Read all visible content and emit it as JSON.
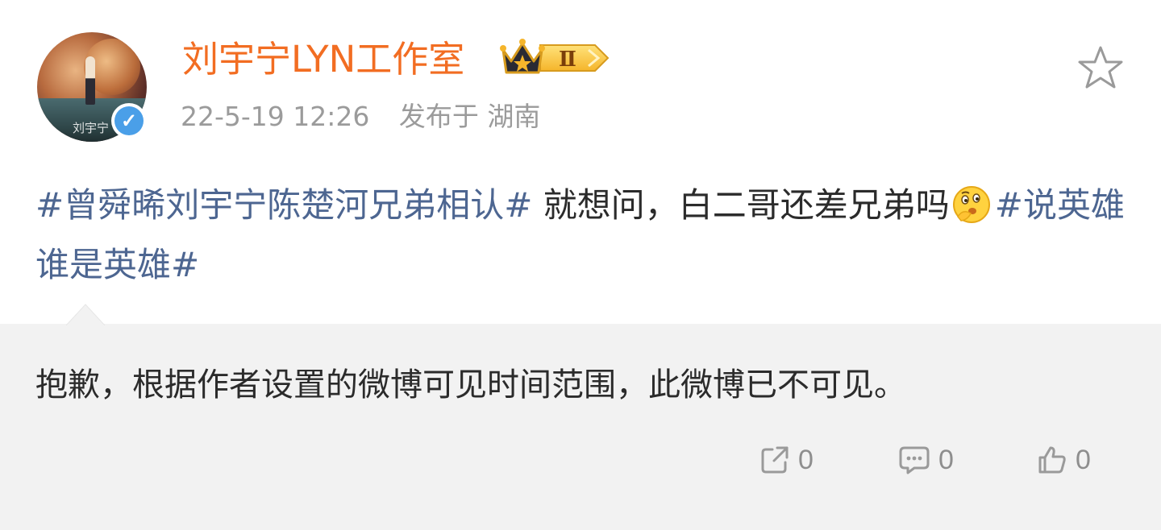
{
  "author": {
    "name": "刘宇宁LYN工作室",
    "avatar_caption": "刘宇宁",
    "verified_icon": "verified-v-icon",
    "vip_badge_icon": "crown-level-badge-icon",
    "vip_level_text": "Ⅱ",
    "name_color": "#f26d22"
  },
  "meta": {
    "timestamp": "22-5-19 12:26",
    "location": "发布于 湖南"
  },
  "post": {
    "topic1": "#曾舜晞刘宇宁陈楚河兄弟相认#",
    "text1": " 就想问，白二哥还差兄弟吗",
    "emoji": "thinking-face-icon",
    "topic2": "#说英雄谁是英雄#",
    "topic_color": "#4d6691"
  },
  "notice": {
    "text": "抱歉，根据作者设置的微博可见时间范围，此微博已不可见。"
  },
  "actions": {
    "forward_count": "0",
    "comment_count": "0",
    "like_count": "0"
  }
}
